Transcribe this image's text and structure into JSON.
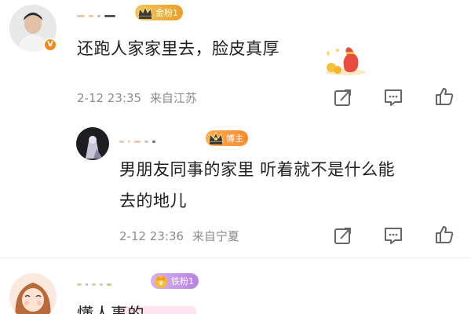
{
  "comments": [
    {
      "badge_label": "金粉1",
      "text": "还跑人家家里去，脸皮真厚",
      "timestamp": "2-12 23:35",
      "location": "来自江苏",
      "verified_mark": "V"
    },
    {
      "badge_label": "博主",
      "text_line1": "男朋友同事的家里 听着就不是什么能",
      "text_line2": "去的地儿",
      "timestamp": "2-12 23:36",
      "location": "来自宁夏"
    },
    {
      "badge_label": "铁粉1",
      "text_partial": "懂人事的"
    }
  ],
  "actions": {
    "share_icon": "share-icon",
    "comment_icon": "comment-icon",
    "like_icon": "thumbs-up-icon"
  },
  "colors": {
    "meta": "#8b8b8b",
    "gold_badge": "#e79f2c",
    "boss_badge": "#ff8a2a",
    "iron_badge": "#b783e4",
    "vip": "#f08a1c"
  }
}
